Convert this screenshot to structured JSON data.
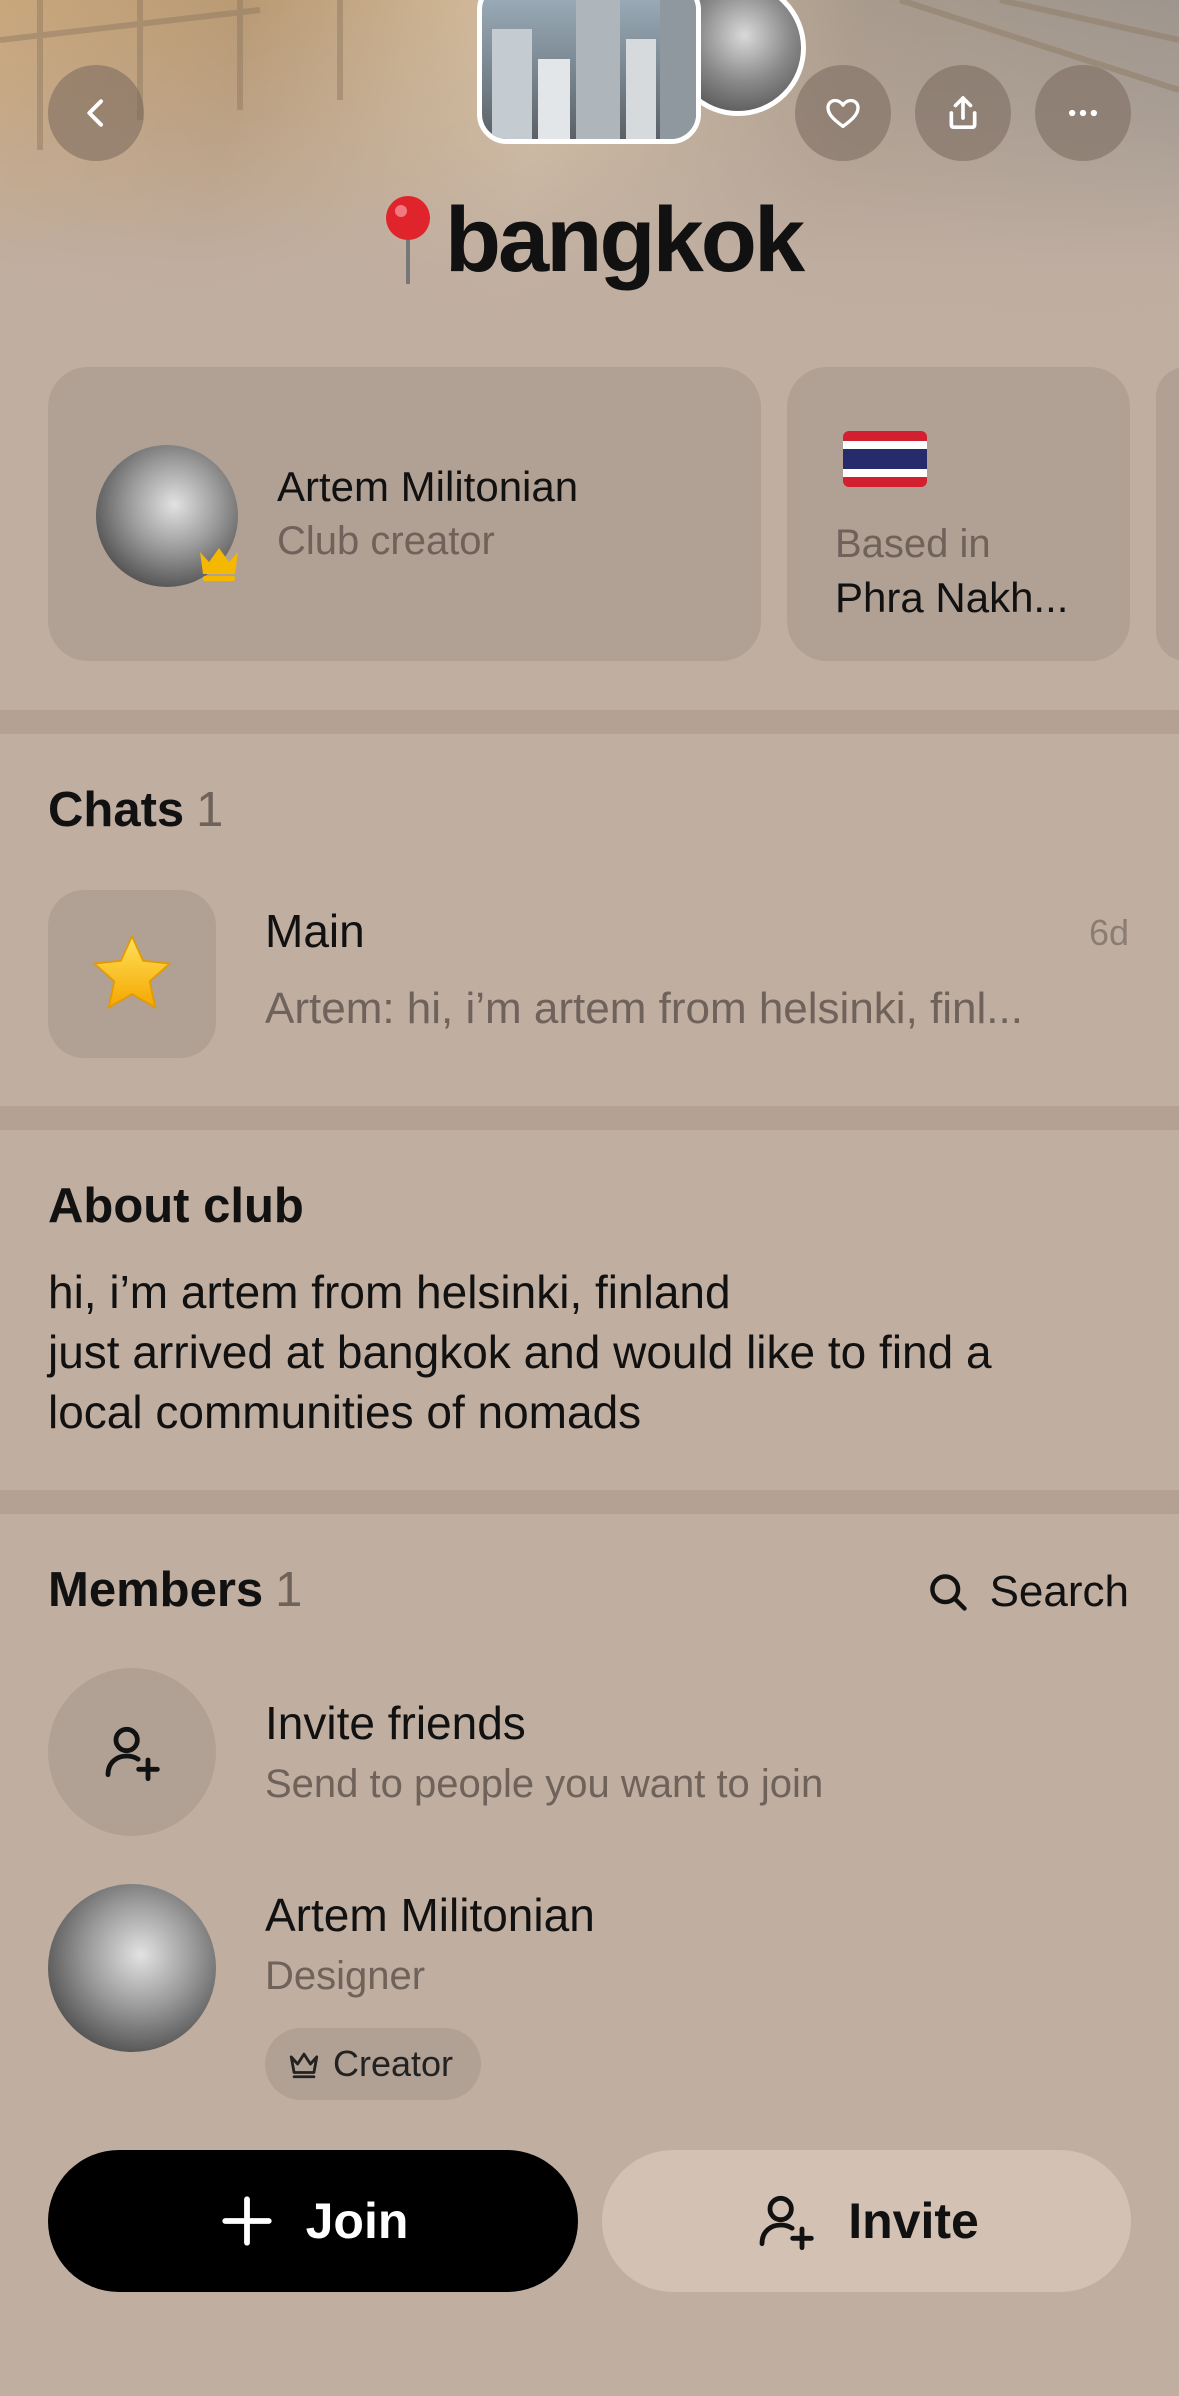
{
  "header": {
    "title": "bangkok",
    "back_icon": "chevron-left-icon",
    "like_icon": "heart-icon",
    "share_icon": "share-icon",
    "more_icon": "more-horizontal-icon"
  },
  "creator_card": {
    "name": "Artem Militonian",
    "role": "Club creator",
    "badge_icon": "crown-icon"
  },
  "location_card": {
    "flag": "thailand-flag",
    "label": "Based in",
    "value": "Phra Nakh..."
  },
  "chats": {
    "title": "Chats",
    "count": "1",
    "items": [
      {
        "icon": "star-icon",
        "name": "Main",
        "time": "6d",
        "preview": "Artem: hi, i’m artem from helsinki, finl..."
      }
    ]
  },
  "about": {
    "title": "About club",
    "text": "hi, i’m artem from helsinki, finland\njust arrived at bangkok and would like to find a\nlocal communities of nomads"
  },
  "members": {
    "title": "Members",
    "count": "1",
    "search_label": "Search",
    "invite": {
      "title": "Invite friends",
      "subtitle": "Send to people you want to join"
    },
    "items": [
      {
        "name": "Artem Militonian",
        "role": "Designer",
        "badge": "Creator"
      }
    ]
  },
  "actions": {
    "join_label": "Join",
    "invite_label": "Invite"
  },
  "colors": {
    "background": "#c0aea1",
    "card": "#b0a094",
    "primary_button": "#000000",
    "secondary_button": "#d3c1b3",
    "crown": "#f5b800"
  }
}
